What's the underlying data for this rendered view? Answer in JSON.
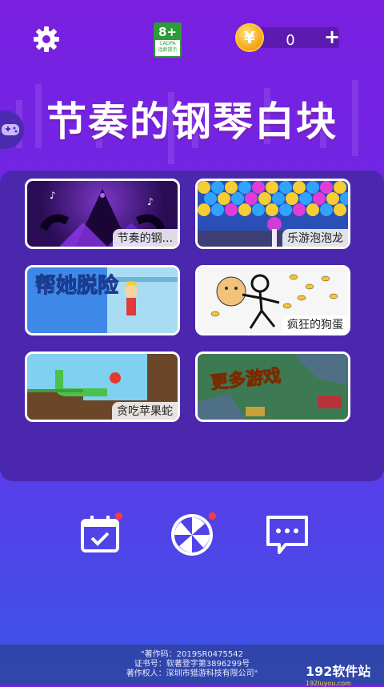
{
  "header": {
    "settings_icon": "gear-icon",
    "age_rating": {
      "num": "8+",
      "org": "CADPA",
      "note": "适龄提示"
    },
    "coins": {
      "icon": "coin-icon",
      "symbol": "¥",
      "count": "0",
      "add": "+"
    }
  },
  "title": "节奏的钢琴白块",
  "side_tab_icon": "gamepad-icon",
  "games": [
    {
      "label": "节奏的钢..."
    },
    {
      "label": "乐游泡泡龙"
    },
    {
      "label": "",
      "art_text": "帮她脱险"
    },
    {
      "label": "疯狂的狗蛋"
    },
    {
      "label": "贪吃苹果蛇"
    },
    {
      "label": "",
      "art_text": "更多游戏"
    }
  ],
  "bottom_nav": [
    {
      "icon": "calendar-check-icon",
      "badge": true
    },
    {
      "icon": "lucky-wheel-icon",
      "badge": true
    },
    {
      "icon": "chat-bubble-icon",
      "badge": false
    }
  ],
  "footer": {
    "line1": "\"著作码：2019SR0475542",
    "line2": "证书号：软著登字第3896299号",
    "line3": "著作权人：深圳市猎游科技有限公司\""
  },
  "watermark": {
    "main": "192软件站",
    "sub": "192luyou.com"
  },
  "colors": {
    "accent_red": "#ff3b3b",
    "bg_top": "#7a1fe0",
    "bg_bottom": "#3a57e6",
    "age_green": "#2f9a3a"
  }
}
